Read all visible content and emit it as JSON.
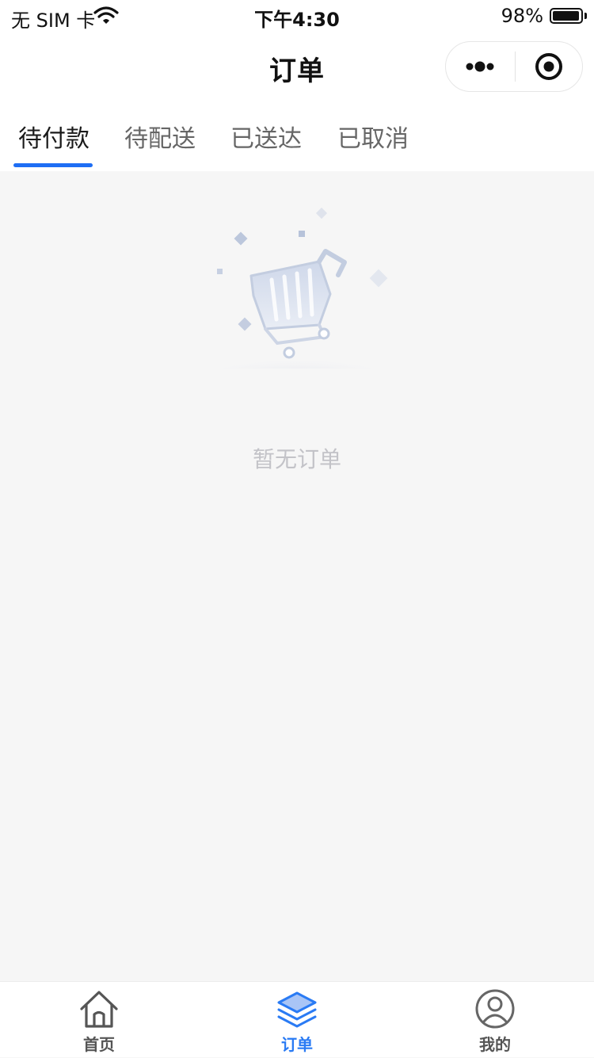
{
  "status_bar": {
    "carrier": "无 SIM 卡",
    "time": "下午4:30",
    "battery": "98%",
    "battery_level": 0.98
  },
  "nav": {
    "title": "订单"
  },
  "tabs": [
    {
      "label": "待付款",
      "active": true
    },
    {
      "label": "待配送",
      "active": false
    },
    {
      "label": "已送达",
      "active": false
    },
    {
      "label": "已取消",
      "active": false
    }
  ],
  "empty_state": {
    "icon": "shopping-cart-icon",
    "text": "暂无订单"
  },
  "tab_bar": {
    "items": [
      {
        "label": "首页",
        "icon": "home-icon",
        "active": false
      },
      {
        "label": "订单",
        "icon": "layers-icon",
        "active": true
      },
      {
        "label": "我的",
        "icon": "user-icon",
        "active": false
      }
    ]
  },
  "colors": {
    "accent": "#1e6ef4",
    "background": "#f6f6f6",
    "tab_active_label": "#2a7bf4"
  }
}
